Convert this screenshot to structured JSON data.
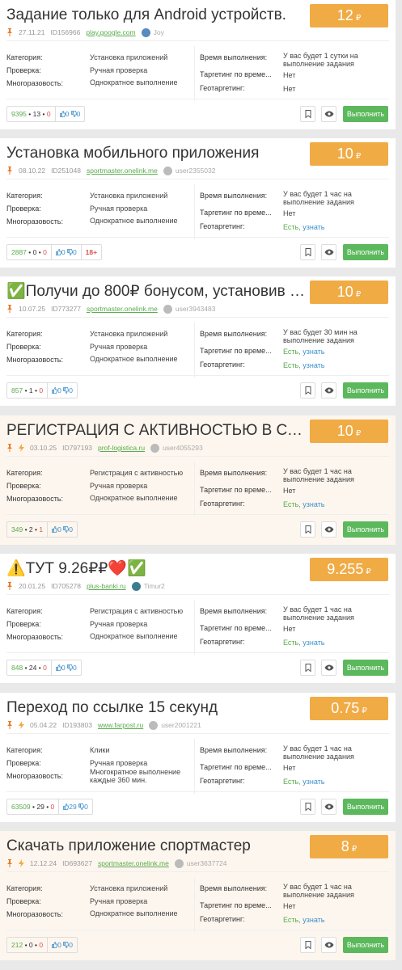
{
  "labels": {
    "category": "Категория:",
    "check": "Проверка:",
    "reuse": "Многоразовость:",
    "time": "Время выполнения:",
    "targeting": "Таргетинг по време...",
    "geo": "Геотаргетинг:",
    "run": "Выполнить",
    "geo_yes": "Есть,",
    "geo_learn": "узнать",
    "currency": "₽"
  },
  "cards": [
    {
      "title": "Задание только для Android устройств.",
      "price": "12",
      "date": "27.11.21",
      "id": "ID156966",
      "domain": "play.google.com",
      "user": "Joy",
      "category": "Установка приложений",
      "check": "Ручная проверка",
      "reuse": "Однократное выполнение",
      "time": "У вас будет 1 сутки на выполнение задания",
      "targeting": "Нет",
      "geo": "Нет",
      "stats": {
        "done": "9395",
        "process": "13",
        "reject": "0",
        "likes": "0",
        "dislikes": "0"
      }
    },
    {
      "title": "Установка мобильного приложения",
      "price": "10",
      "date": "08.10.22",
      "id": "ID251048",
      "domain": "sportmaster.onelink.me",
      "user": "user2355032",
      "category": "Установка приложений",
      "check": "Ручная проверка",
      "reuse": "Однократное выполнение",
      "time": "У вас будет 1 час на выполнение задания",
      "targeting": "Нет",
      "geo": "Есть",
      "stats": {
        "done": "2887",
        "process": "0",
        "reject": "0",
        "likes": "0",
        "dislikes": "0"
      },
      "age": "18+"
    },
    {
      "title": "✅Получи до 800₽ бонусом, установив приложение",
      "price": "10",
      "date": "10.07.25",
      "id": "ID773277",
      "domain": "sportmaster.onelink.me",
      "user": "user3943483",
      "category": "Установка приложений",
      "check": "Ручная проверка",
      "reuse": "Однократное выполнение",
      "time": "У вас будет 30 мин на выполнение задания",
      "targeting": "Есть",
      "geo": "Есть",
      "stats": {
        "done": "857",
        "process": "1",
        "reject": "0",
        "likes": "0",
        "dislikes": "0"
      }
    },
    {
      "title": "РЕГИСТРАЦИЯ С АКТИВНОСТЬЮ В СОЦСЕТЯХ",
      "price": "10",
      "date": "03.10.25",
      "id": "ID797193",
      "domain": "prof-logistica.ru",
      "user": "user4055293",
      "category": "Регистрация с активностью",
      "check": "Ручная проверка",
      "reuse": "Однократное выполнение",
      "time": "У вас будет 1 час на выполнение задания",
      "targeting": "Нет",
      "geo": "Есть",
      "stats": {
        "done": "349",
        "process": "2",
        "reject": "1",
        "likes": "0",
        "dislikes": "0"
      }
    },
    {
      "title": "⚠️ТУТ 9.26₽₽❤️✅",
      "price": "9.255",
      "date": "20.01.25",
      "id": "ID705278",
      "domain": "plus-banki.ru",
      "user": "Timur2",
      "category": "Регистрация с активностью",
      "check": "Ручная проверка",
      "reuse": "Однократное выполнение",
      "time": "У вас будет 1 час на выполнение задания",
      "targeting": "Нет",
      "geo": "Есть",
      "stats": {
        "done": "848",
        "process": "24",
        "reject": "0",
        "likes": "0",
        "dislikes": "0"
      }
    },
    {
      "title": "Переход по ссылке 15 секунд",
      "price": "0.75",
      "date": "05.04.22",
      "id": "ID193803",
      "domain": "www.farpost.ru",
      "user": "user2001221",
      "category": "Клики",
      "check": "Ручная проверка",
      "reuse": "Многократное выполнение каждые 360 мин.",
      "time": "У вас будет 1 час на выполнение задания",
      "targeting": "Нет",
      "geo": "Есть",
      "stats": {
        "done": "63509",
        "process": "29",
        "reject": "0",
        "likes": "29",
        "dislikes": "0"
      }
    },
    {
      "title": "Скачать приложение спортмастер",
      "price": "8",
      "date": "12.12.24",
      "id": "ID693627",
      "domain": "sportmaster.onelink.me",
      "user": "user3637724",
      "category": "Установка приложений",
      "check": "Ручная проверка",
      "reuse": "Однократное выполнение",
      "time": "У вас будет 1 час на выполнение задания",
      "targeting": "Нет",
      "geo": "Есть",
      "stats": {
        "done": "212",
        "process": "0",
        "reject": "0",
        "likes": "0",
        "dislikes": "0"
      }
    }
  ]
}
